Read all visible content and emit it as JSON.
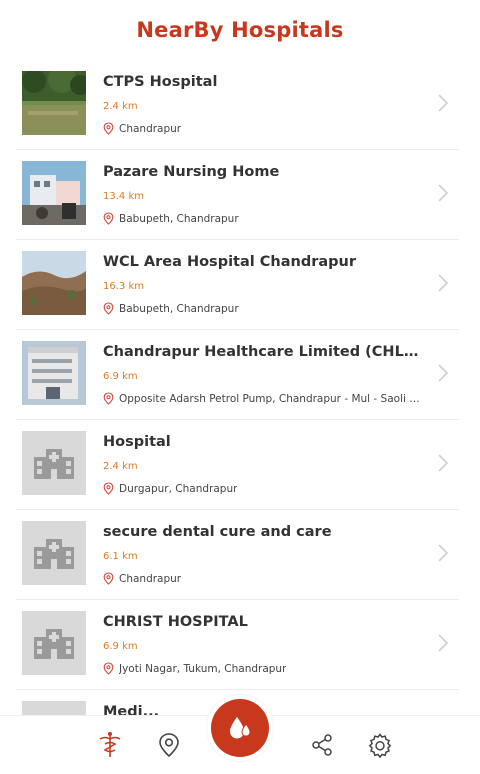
{
  "header": {
    "title": "NearBy Hospitals"
  },
  "hospitals": [
    {
      "name": "CTPS Hospital",
      "distance": "2.4 km",
      "address": "Chandrapur",
      "thumb": "park-photo"
    },
    {
      "name": "Pazare Nursing Home",
      "distance": "13.4 km",
      "address": "Babupeth, Chandrapur",
      "thumb": "street-photo"
    },
    {
      "name": "WCL Area Hospital Chandrapur",
      "distance": "16.3 km",
      "address": "Babupeth, Chandrapur",
      "thumb": "hills-photo"
    },
    {
      "name": "Chandrapur Healthcare Limited (CHL) Mul...",
      "distance": "6.9 km",
      "address": "Opposite Adarsh Petrol Pump, Chandrapur - Mul - Saoli - Ga...",
      "thumb": "building-photo"
    },
    {
      "name": "Hospital",
      "distance": "2.4 km",
      "address": "Durgapur, Chandrapur",
      "thumb": "placeholder-hospital-icon"
    },
    {
      "name": "secure dental cure and care",
      "distance": "6.1 km",
      "address": "Chandrapur",
      "thumb": "placeholder-hospital-icon"
    },
    {
      "name": "CHRIST HOSPITAL",
      "distance": "6.9 km",
      "address": "Jyoti Nagar, Tukum, Chandrapur",
      "thumb": "placeholder-hospital-icon"
    },
    {
      "name": "Medi...",
      "distance": "",
      "address": "",
      "thumb": "placeholder-hospital-icon"
    }
  ],
  "bottom_nav": {
    "items": [
      {
        "icon": "caduceus-icon",
        "active": true
      },
      {
        "icon": "map-pin-icon",
        "active": false
      },
      {
        "icon": "blood-drop-icon",
        "active": false
      },
      {
        "icon": "share-icon",
        "active": false
      },
      {
        "icon": "gear-icon",
        "active": false
      }
    ]
  },
  "colors": {
    "accent": "#c8381c",
    "distance": "#e07b25",
    "placeholder_bg": "#d9d9d9"
  }
}
